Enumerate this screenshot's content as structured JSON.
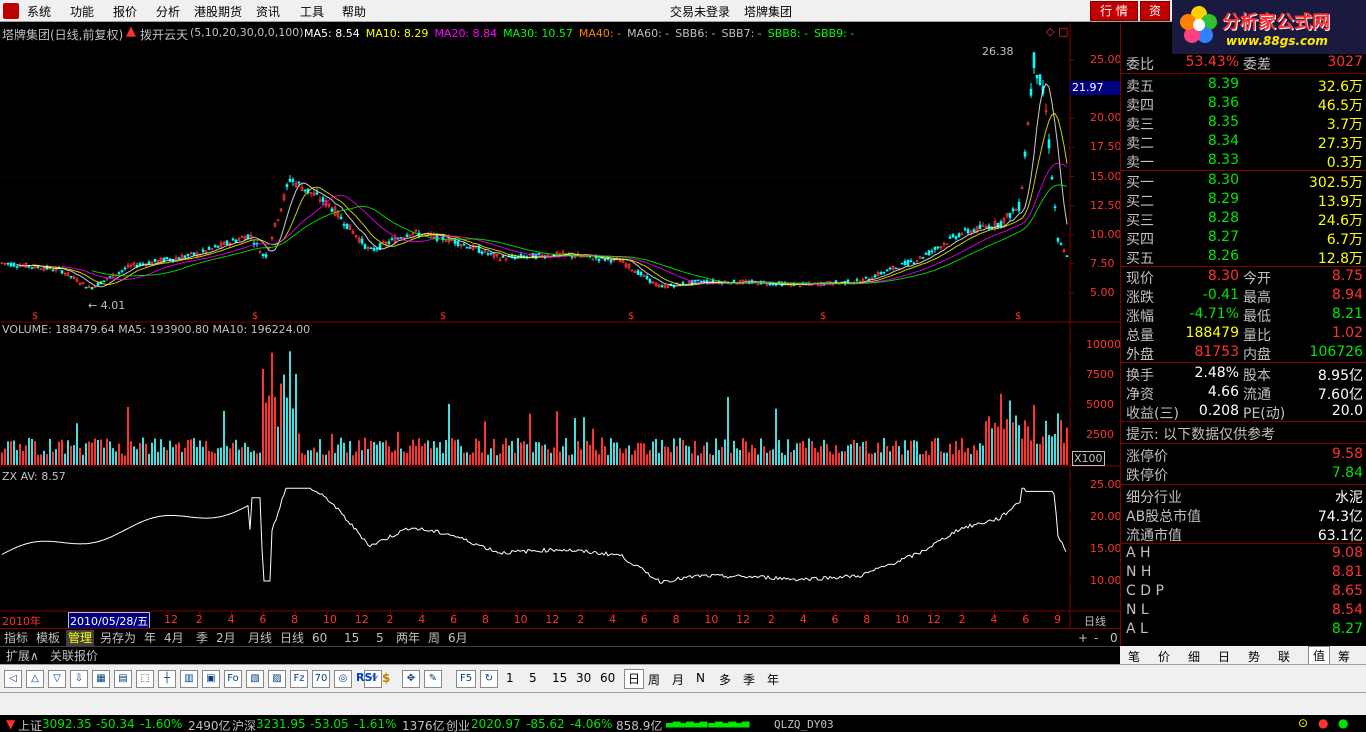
{
  "menu": {
    "items": [
      "系统",
      "功能",
      "报价",
      "分析",
      "港股期货",
      "资讯",
      "工具",
      "帮助"
    ],
    "login_status": "交易未登录",
    "stock_name": "塔牌集团",
    "quote_button": "行 情",
    "info_button": "资"
  },
  "logo": {
    "title": "分析家公式网",
    "url": "www.88gs.com"
  },
  "chart": {
    "title": "塔牌集团(日线,前复权)",
    "indicator_name": "拨开云天",
    "indicator_params": "(5,10,20,30,0,0,100)",
    "ma_labels": [
      {
        "text": "MA5: 8.54",
        "color": "#ffffff"
      },
      {
        "text": "MA10: 8.29",
        "color": "#ffff00"
      },
      {
        "text": "MA20: 8.84",
        "color": "#ff00ff"
      },
      {
        "text": "MA30: 10.57",
        "color": "#00ff00"
      },
      {
        "text": "MA40: -",
        "color": "#ff8000"
      },
      {
        "text": "MA60: -",
        "color": "#c0c0c0"
      },
      {
        "text": "SBB6: -",
        "color": "#c0c0c0"
      },
      {
        "text": "SBB7: -",
        "color": "#c0c0c0"
      },
      {
        "text": "SBB8: -",
        "color": "#00ff00"
      },
      {
        "text": "SBB9: -",
        "color": "#00ff00"
      }
    ],
    "price_axis": [
      "25.00",
      "22.50",
      "20.00",
      "17.50",
      "15.00",
      "12.50",
      "10.00",
      "7.50",
      "5.00"
    ],
    "current_price_tag": "21.97",
    "high_label": "26.38",
    "low_label": "4.01",
    "volume_title": "VOLUME: 188479.64  MA5: 193900.80  MA10: 196224.00",
    "volume_axis": [
      "10000",
      "7500",
      "5000",
      "2500"
    ],
    "volume_unit": "X100",
    "zx_title": "ZX AV: 8.57",
    "zx_axis": [
      "25.00",
      "20.00",
      "15.00",
      "10.00"
    ],
    "date_axis": {
      "year": "2010年",
      "cursor_date": "2010/05/28/五",
      "ticks": [
        "12",
        "2",
        "4",
        "6",
        "8",
        "10",
        "12",
        "2",
        "4",
        "6",
        "8",
        "10",
        "12",
        "2",
        "4",
        "6",
        "8",
        "10",
        "12",
        "2",
        "4",
        "6",
        "8",
        "10",
        "12",
        "2",
        "4",
        "6",
        "9"
      ],
      "period": "日线"
    }
  },
  "tabs_row1": [
    "指标",
    "模板",
    "管理",
    "另存为",
    "年",
    "4月",
    "季",
    "2月",
    "月线",
    "日线",
    "60",
    "15",
    "5",
    "两年",
    "周",
    "6月"
  ],
  "tabs_row1_active": "管理",
  "tabs_row1_right": [
    "+",
    "-",
    "0"
  ],
  "tabs_row2": [
    "扩展∧",
    "关联报价"
  ],
  "quote_panel": {
    "weibi": {
      "label": "委比",
      "value": "53.43%",
      "label2": "委差",
      "value2": "3027"
    },
    "sell": [
      {
        "label": "卖五",
        "price": "8.39",
        "vol": "32.6万"
      },
      {
        "label": "卖四",
        "price": "8.36",
        "vol": "46.5万"
      },
      {
        "label": "卖三",
        "price": "8.35",
        "vol": "3.7万"
      },
      {
        "label": "卖二",
        "price": "8.34",
        "vol": "27.3万"
      },
      {
        "label": "卖一",
        "price": "8.33",
        "vol": "0.3万"
      }
    ],
    "buy": [
      {
        "label": "买一",
        "price": "8.30",
        "vol": "302.5万"
      },
      {
        "label": "买二",
        "price": "8.29",
        "vol": "13.9万"
      },
      {
        "label": "买三",
        "price": "8.28",
        "vol": "24.6万"
      },
      {
        "label": "买四",
        "price": "8.27",
        "vol": "6.7万"
      },
      {
        "label": "买五",
        "price": "8.26",
        "vol": "12.8万"
      }
    ],
    "stats1": [
      {
        "l1": "现价",
        "v1": "8.30",
        "c1": "#ff3232",
        "l2": "今开",
        "v2": "8.75",
        "c2": "#ff3232"
      },
      {
        "l1": "涨跌",
        "v1": "-0.41",
        "c1": "#00e600",
        "l2": "最高",
        "v2": "8.94",
        "c2": "#ff3232"
      },
      {
        "l1": "涨幅",
        "v1": "-4.71%",
        "c1": "#00e600",
        "l2": "最低",
        "v2": "8.21",
        "c2": "#00e600"
      },
      {
        "l1": "总量",
        "v1": "188479",
        "c1": "#ffff00",
        "l2": "量比",
        "v2": "1.02",
        "c2": "#ff3232"
      },
      {
        "l1": "外盘",
        "v1": "81753",
        "c1": "#ff3232",
        "l2": "内盘",
        "v2": "106726",
        "c2": "#00e600"
      }
    ],
    "stats2": [
      {
        "l1": "换手",
        "v1": "2.48%",
        "l2": "股本",
        "v2": "8.95亿"
      },
      {
        "l1": "净资",
        "v1": "4.66",
        "l2": "流通",
        "v2": "7.60亿"
      },
      {
        "l1": "收益(三)",
        "v1": "0.208",
        "l2": "PE(动)",
        "v2": "20.0"
      }
    ],
    "hint": "提示: 以下数据仅供参考",
    "limits": [
      {
        "label": "涨停价",
        "value": "9.58",
        "color": "#ff3232"
      },
      {
        "label": "跌停价",
        "value": "7.84",
        "color": "#00e600"
      }
    ],
    "industry": [
      {
        "label": "细分行业",
        "value": "水泥"
      },
      {
        "label": "AB股总市值",
        "value": "74.3亿"
      },
      {
        "label": "流通市值",
        "value": "63.1亿"
      }
    ],
    "indicators": [
      {
        "label": "A H",
        "value": "9.08",
        "color": "#ff3232"
      },
      {
        "label": "N H",
        "value": "8.81",
        "color": "#ff3232"
      },
      {
        "label": "C D P",
        "value": "8.65",
        "color": "#ff3232"
      },
      {
        "label": "N L",
        "value": "8.54",
        "color": "#ff3232"
      },
      {
        "label": "A L",
        "value": "8.27",
        "color": "#00e600"
      }
    ]
  },
  "right_tabs": [
    "笔",
    "价",
    "细",
    "日",
    "势",
    "联",
    "值",
    "筹"
  ],
  "right_tabs_active": "值",
  "toolbar": {
    "periods": [
      "1",
      "5",
      "15",
      "30",
      "60",
      "日",
      "周",
      "月",
      "N",
      "多",
      "季",
      "年"
    ],
    "active_period": "日",
    "rsi_label": "RSI",
    "f5_label": "F5"
  },
  "statusbar": {
    "sh_label": "上证",
    "sh_value": "3092.35",
    "sh_change": "-50.34",
    "sh_pct": "-1.60%",
    "sh_amount": "2490亿",
    "sz_label": "沪深",
    "sz_value": "3231.95",
    "sz_change": "-53.05",
    "sz_pct": "-1.61%",
    "sz_amount": "1376亿",
    "cy_label": "创业",
    "cy_value": "2020.97",
    "cy_change": "-85.62",
    "cy_pct": "-4.06%",
    "cy_amount": "858.9亿",
    "server": "QLZQ_DY03"
  },
  "colors": {
    "up": "#ff3232",
    "down": "#00e600",
    "axis": "#800000",
    "grid": "#400000"
  }
}
